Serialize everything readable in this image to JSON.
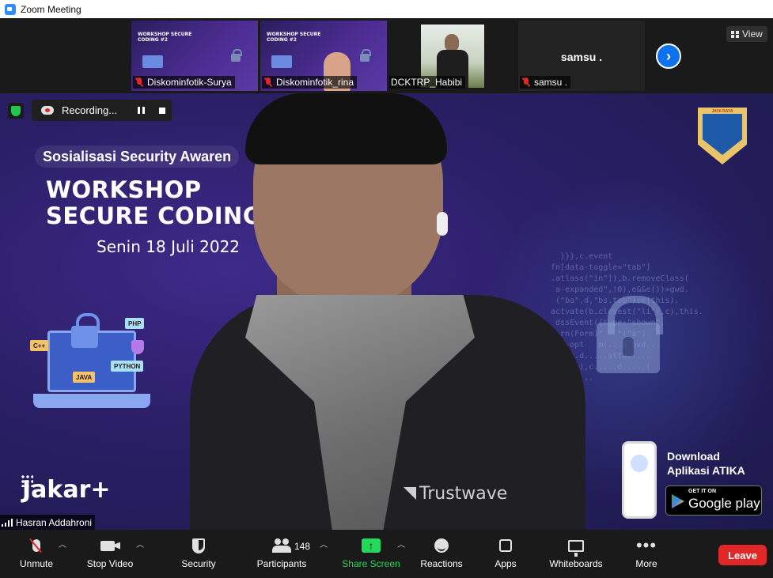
{
  "window": {
    "title": "Zoom Meeting"
  },
  "participants_strip": {
    "items": [
      {
        "name": "Diskominfotik-Surya",
        "muted": true,
        "kind": "slide",
        "slide_title": "WORKSHOP SECURE CODING #2"
      },
      {
        "name": "Diskominfotik_rina",
        "muted": true,
        "kind": "slide",
        "slide_title": "WORKSHOP SECURE CODING #2"
      },
      {
        "name": "DCKTRP_Habibi",
        "muted": false,
        "kind": "photo"
      },
      {
        "name": "samsu .",
        "muted": true,
        "kind": "name-only",
        "display_name": "samsu ."
      }
    ],
    "next_arrow": "›",
    "view_label": "View"
  },
  "recording": {
    "label": "Recording..."
  },
  "slide": {
    "subtitle": "Sosialisasi Security Awaren",
    "title_line1": "WORKSHOP",
    "title_line2": "SECURE CODING",
    "date": "Senin 18 Juli 2022",
    "tags": [
      "C++",
      "PHP",
      "JAVA",
      "PYTHON"
    ],
    "jakarta_logo": "Jakar+",
    "download_line1": "Download",
    "download_line2": "Aplikasi ATIKA",
    "get_it_on": "GET IT ON",
    "google_play": "Google play",
    "emblem_text": "JAYA RAYA"
  },
  "presenter": {
    "name": "Hasran Addahroni",
    "shirt_logo": "Trustwave"
  },
  "toolbar": {
    "unmute": "Unmute",
    "stop_video": "Stop Video",
    "security": "Security",
    "participants": "Participants",
    "participants_count": "148",
    "share_screen": "Share Screen",
    "reactions": "Reactions",
    "apps": "Apps",
    "whiteboards": "Whiteboards",
    "more": "More",
    "leave": "Leave"
  },
  "colors": {
    "accent_blue": "#0e72ed",
    "share_green": "#23d959",
    "leave_red": "#e02828",
    "slide_purple": "#3f2a8a"
  }
}
